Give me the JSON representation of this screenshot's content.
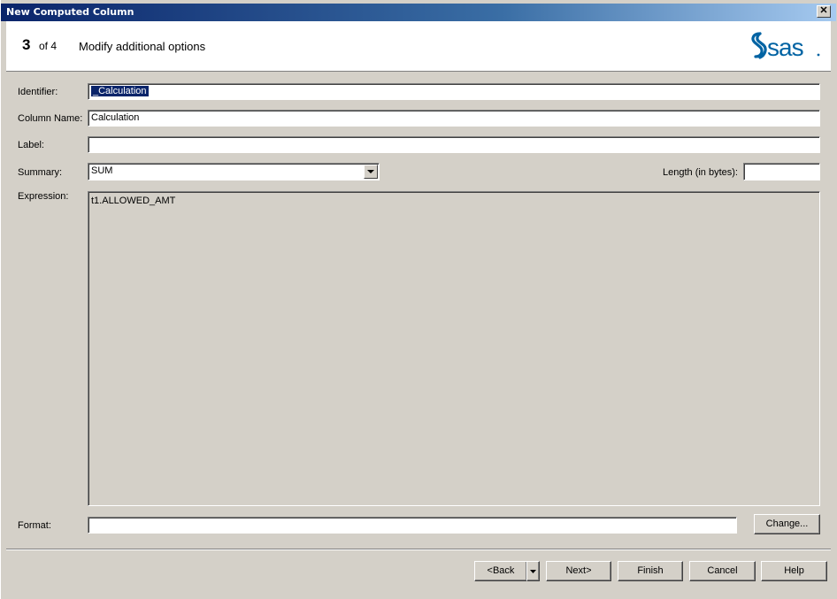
{
  "window": {
    "title": "New Computed Column"
  },
  "header": {
    "step_number": "3",
    "step_of": "of 4",
    "step_title": "Modify additional options",
    "logo_text": "sas"
  },
  "form": {
    "identifier": {
      "label": "Identifier:",
      "value": "_Calculation"
    },
    "column_name": {
      "label": "Column Name:",
      "value": "Calculation"
    },
    "label": {
      "label": "Label:",
      "value": ""
    },
    "summary": {
      "label": "Summary:",
      "value": "SUM"
    },
    "length": {
      "label": "Length (in bytes):",
      "value": ""
    },
    "expression": {
      "label": "Expression:",
      "value": "t1.ALLOWED_AMT"
    },
    "format": {
      "label": "Format:",
      "value": "",
      "change_label": "Change..."
    }
  },
  "buttons": {
    "back": "<Back",
    "next": "Next>",
    "finish": "Finish",
    "cancel": "Cancel",
    "help": "Help"
  },
  "colors": {
    "title_start": "#0a246a",
    "title_end": "#a6caf0",
    "sas_blue": "#0063a3",
    "face": "#d4d0c8"
  },
  "icons": {
    "close": "close-icon",
    "dropdown": "chevron-down-icon",
    "logo": "sas-logo"
  }
}
